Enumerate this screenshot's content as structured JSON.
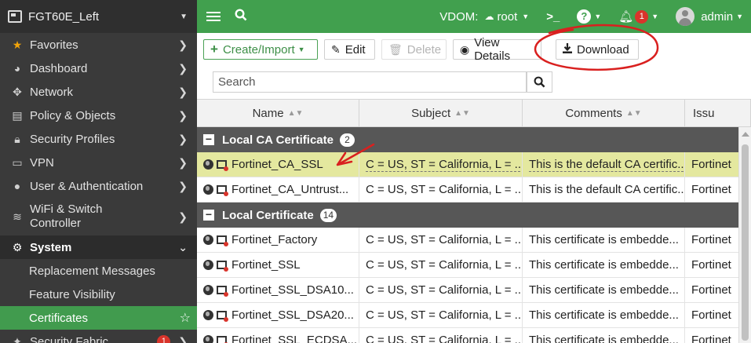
{
  "sidebar": {
    "device": "FGT60E_Left",
    "items": [
      {
        "icon": "star-icon",
        "label": "Favorites"
      },
      {
        "icon": "dashboard-icon",
        "label": "Dashboard"
      },
      {
        "icon": "network-icon",
        "label": "Network"
      },
      {
        "icon": "policy-icon",
        "label": "Policy & Objects"
      },
      {
        "icon": "lock-icon",
        "label": "Security Profiles"
      },
      {
        "icon": "vpn-icon",
        "label": "VPN"
      },
      {
        "icon": "user-icon",
        "label": "User & Authentication"
      },
      {
        "icon": "wifi-icon",
        "label": "WiFi & Switch Controller"
      },
      {
        "icon": "gear-icon",
        "label": "System"
      }
    ],
    "system_sub": [
      "Replacement Messages",
      "Feature Visibility",
      "Certificates"
    ],
    "next_item": {
      "label": "Security Fabric",
      "badge": "1"
    }
  },
  "topbar": {
    "vdom_label": "VDOM:",
    "vdom_value": "root",
    "cli": ">_",
    "help": "?",
    "notif_count": "1",
    "user": "admin"
  },
  "toolbar": {
    "create": "Create/Import",
    "edit": "Edit",
    "delete": "Delete",
    "view": "View Details",
    "download": "Download"
  },
  "search": {
    "placeholder": "Search"
  },
  "table": {
    "columns": [
      "Name",
      "Subject",
      "Comments",
      "Issu"
    ],
    "groups": [
      {
        "label": "Local CA Certificate",
        "count": "2",
        "rows": [
          {
            "name": "Fortinet_CA_SSL",
            "subject": "C = US, ST = California, L = ...",
            "comments": "This is the default CA certific...",
            "issuer": "Fortinet"
          },
          {
            "name": "Fortinet_CA_Untrust...",
            "subject": "C = US, ST = California, L = ...",
            "comments": "This is the default CA certific...",
            "issuer": "Fortinet"
          }
        ]
      },
      {
        "label": "Local Certificate",
        "count": "14",
        "rows": [
          {
            "name": "Fortinet_Factory",
            "subject": "C = US, ST = California, L = ...",
            "comments": "This certificate is embedde...",
            "issuer": "Fortinet"
          },
          {
            "name": "Fortinet_SSL",
            "subject": "C = US, ST = California, L = ...",
            "comments": "This certificate is embedde...",
            "issuer": "Fortinet"
          },
          {
            "name": "Fortinet_SSL_DSA10...",
            "subject": "C = US, ST = California, L = ...",
            "comments": "This certificate is embedde...",
            "issuer": "Fortinet"
          },
          {
            "name": "Fortinet_SSL_DSA20...",
            "subject": "C = US, ST = California, L = ...",
            "comments": "This certificate is embedde...",
            "issuer": "Fortinet"
          },
          {
            "name": "Fortinet_SSL_ECDSA...",
            "subject": "C = US, ST = California, L = ...",
            "comments": "This certificate is embedde...",
            "issuer": "Fortinet"
          }
        ]
      }
    ]
  },
  "colors": {
    "accent": "#41a04e",
    "selected_row": "#e4e89f",
    "annotation": "#d9201f"
  }
}
